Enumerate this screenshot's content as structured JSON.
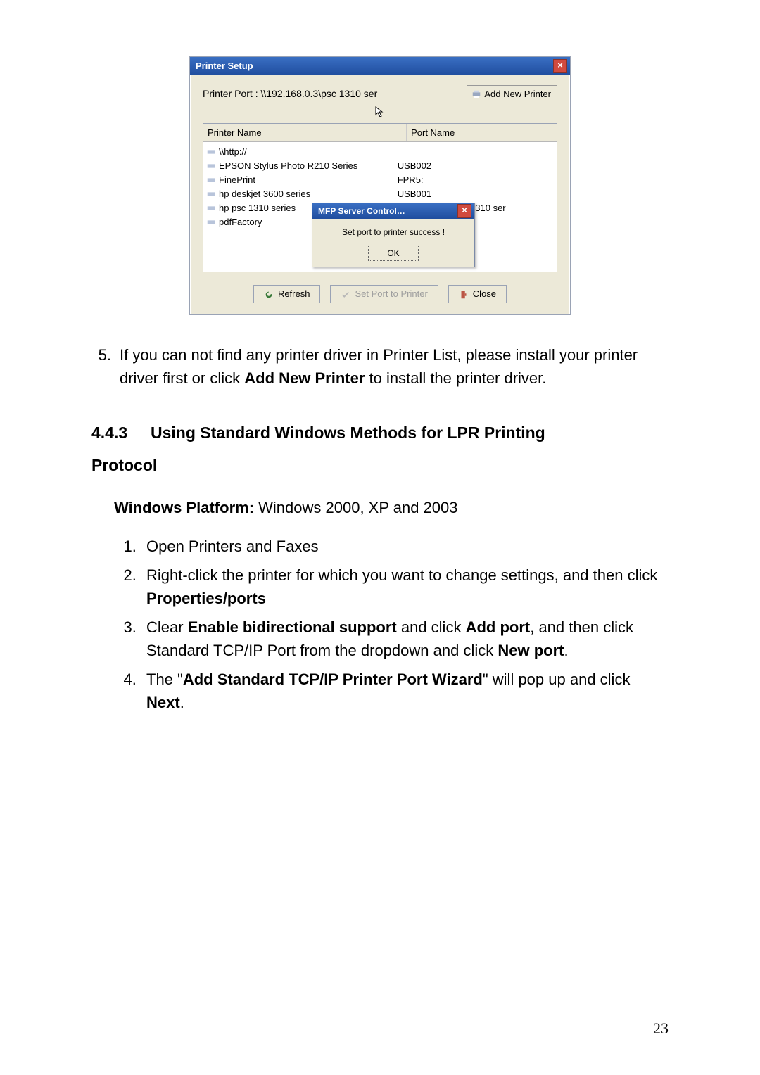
{
  "screenshot": {
    "window_title": "Printer Setup",
    "printer_port_label": "Printer Port :  \\\\192.168.0.3\\psc 1310 ser",
    "add_new_printer": "Add New Printer",
    "columns": {
      "name": "Printer Name",
      "port": "Port Name"
    },
    "rows": [
      {
        "name": "\\\\http://",
        "port": ""
      },
      {
        "name": "EPSON Stylus Photo R210 Series",
        "port": "USB002"
      },
      {
        "name": "FinePrint",
        "port": "FPR5:"
      },
      {
        "name": "hp deskjet 3600 series",
        "port": "USB001"
      },
      {
        "name": "hp psc 1310 series",
        "port": "\\\\192.168.0.3\\psc 1310 ser"
      },
      {
        "name": "pdfFactory",
        "port": ""
      }
    ],
    "popup": {
      "title": "MFP Server Control…",
      "message": "Set port to printer success !",
      "ok": "OK"
    },
    "buttons": {
      "refresh": "Refresh",
      "set_port": "Set Port to Printer",
      "close": "Close"
    }
  },
  "doc": {
    "para5": {
      "num": "5.",
      "t1": "If you can not find any printer driver in Printer List, please install your printer driver first or click ",
      "b1": "Add New Printer",
      "t2": " to install the printer driver."
    },
    "sec_number": "4.4.3",
    "sec_title": "Using Standard Windows Methods for LPR Printing",
    "protocol": "Protocol",
    "win_label": "Windows Platform:",
    "win_value": " Windows 2000, XP and 2003",
    "steps": {
      "s1": "Open Printers and Faxes",
      "s2a": "Right-click the printer for which you want to change settings, and then click ",
      "s2b": "Properties/ports",
      "s3a": "Clear ",
      "s3b": "Enable bidirectional support",
      "s3c": " and click ",
      "s3d": "Add port",
      "s3e": ", and then click Standard TCP/IP Port from the dropdown and click ",
      "s3f": "New port",
      "s3g": ".",
      "s4a": "The \"",
      "s4b": "Add Standard TCP/IP Printer Port Wizard",
      "s4c": "\" will pop up and click ",
      "s4d": "Next",
      "s4e": "."
    },
    "page_number": "23"
  }
}
